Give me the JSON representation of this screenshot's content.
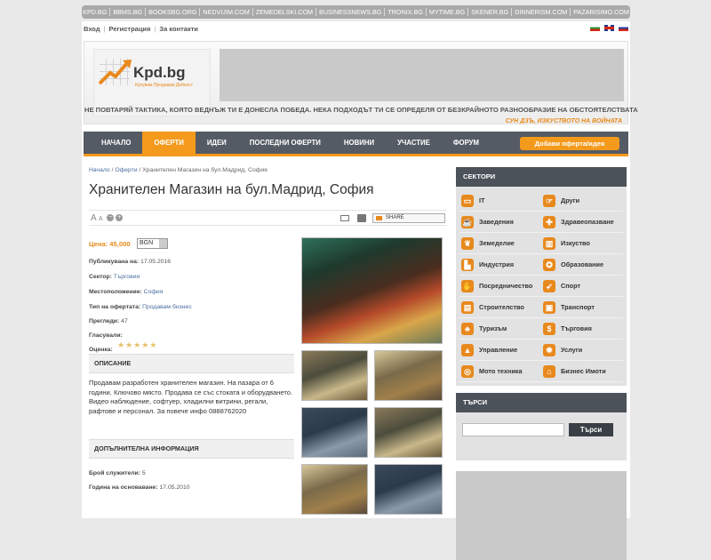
{
  "network": [
    "KPD.BG",
    "BBMS.BG",
    "BOOKSBG.ORG",
    "NEDVIJIM.COM",
    "ZEMEDELSKI.COM",
    "BUSINESSNEWS.BG",
    "TRONIX.BG",
    "MYTIME.BG",
    "SKENER.BG",
    "DINNERISM.COM",
    "PAZARISIMO.COM"
  ],
  "userbar": {
    "login": "Вход",
    "register": "Регистрация",
    "contacts": "За контакти"
  },
  "logo": {
    "name": "Kpd.bg",
    "tagline": "Купувам Продавам Дейност"
  },
  "quote": {
    "text": "НЕ ПОВТАРЯЙ ТАКТИКА, КОЯТО ВЕДНЪЖ ТИ Е ДОНЕСЛА ПОБЕДА. НЕКА ПОДХОДЪТ ТИ СЕ ОПРЕДЕЛЯ ОТ БЕЗКРАЙНОТО РАЗНООБРАЗИЕ НА ОБСТОЯТЕЛСТВАТА",
    "author": "СУН ДЗЪ, ИЗКУСТВОТО НА ВОЙНАТА"
  },
  "nav": [
    "НАЧАЛО",
    "ОФЕРТИ",
    "ИДЕИ",
    "ПОСЛЕДНИ ОФЕРТИ",
    "НОВИНИ",
    "УЧАСТИЕ",
    "ФОРУМ"
  ],
  "add_button": "Добави оферта/идея",
  "breadcrumb": {
    "home": "Начало",
    "offers": "Оферти",
    "current": "Хранителен Магазин на бул.Мадрид, София"
  },
  "title": "Хранителен Магазин на бул.Мадрид, София",
  "toolbar": {
    "share": "SHARE"
  },
  "price": {
    "label": "Цена: 45,000",
    "currency": "BGN"
  },
  "details": [
    {
      "label": "Публикувана на:",
      "value": "17.05.2016"
    },
    {
      "label": "Сектор:",
      "value": "Търговия"
    },
    {
      "label": "Местоположение:",
      "value": "София"
    },
    {
      "label": "Тип на офертата:",
      "value": "Продавам бизнес"
    },
    {
      "label": "Прегледи:",
      "value": "47"
    },
    {
      "label": "Гласували:",
      "value": ""
    },
    {
      "label": "Оценка:",
      "value": ""
    }
  ],
  "rating": 0,
  "description": {
    "heading": "ОПИСАНИЕ",
    "text": "Продавам разработен хранителен магазин. На пазара от 6 години. Ключово място. Продава се със стоката и оборудването. Видео наблюдение, софтуер, хладилни витрини, регали, рафтове и персонал. За повече инфо 0888762020"
  },
  "extra": {
    "heading": "ДОПЪЛНИТЕЛНА ИНФОРМАЦИЯ",
    "employees_label": "Брой служители:",
    "employees": "5",
    "founded_label": "Година на основаване:",
    "founded": "17.05.2010"
  },
  "sidebar": {
    "sectors_title": "СЕКТОРИ",
    "sectors": [
      {
        "label": "IT",
        "icon": "monitor-icon",
        "color": "#e8891d"
      },
      {
        "label": "Други",
        "icon": "pointer-icon",
        "color": "#e8891d"
      },
      {
        "label": "Заведения",
        "icon": "cup-icon",
        "color": "#e8891d"
      },
      {
        "label": "Здравеопазване",
        "icon": "cross-icon",
        "color": "#e8891d"
      },
      {
        "label": "Земеделие",
        "icon": "wheat-icon",
        "color": "#e8891d"
      },
      {
        "label": "Изкуство",
        "icon": "museum-icon",
        "color": "#e8891d"
      },
      {
        "label": "Индустрия",
        "icon": "factory-icon",
        "color": "#e8891d"
      },
      {
        "label": "Образование",
        "icon": "medal-icon",
        "color": "#e8891d"
      },
      {
        "label": "Посредничество",
        "icon": "hand-icon",
        "color": "#e8891d"
      },
      {
        "label": "Спорт",
        "icon": "runner-icon",
        "color": "#e8891d"
      },
      {
        "label": "Строителство",
        "icon": "building-icon",
        "color": "#e8891d"
      },
      {
        "label": "Транспорт",
        "icon": "bus-icon",
        "color": "#e8891d"
      },
      {
        "label": "Туризъм",
        "icon": "palm-icon",
        "color": "#e8891d"
      },
      {
        "label": "Търговия",
        "icon": "dollar-icon",
        "color": "#e8891d"
      },
      {
        "label": "Управление",
        "icon": "chart-icon",
        "color": "#e8891d"
      },
      {
        "label": "Услуги",
        "icon": "gear-icon",
        "color": "#e8891d"
      },
      {
        "label": "Мото техника",
        "icon": "motorbike-icon",
        "color": "#e8891d"
      },
      {
        "label": "Бизнес Имоти",
        "icon": "house-icon",
        "color": "#e8891d"
      }
    ],
    "search_title": "ТЪРСИ",
    "search_button": "Търси"
  }
}
